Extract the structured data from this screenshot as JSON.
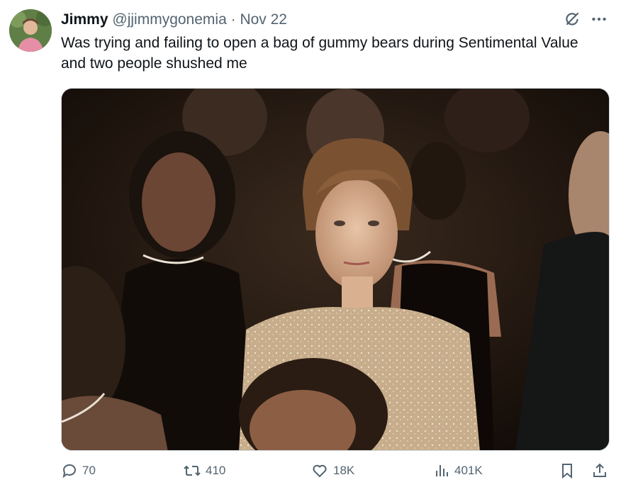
{
  "tweet": {
    "author_name": "Jimmy",
    "handle": "@jjimmygonemia",
    "separator": "·",
    "date": "Nov 22",
    "text": "Was trying and failing to open a bag of gummy bears during Sentimental Value and two people shushed me"
  },
  "icons": {
    "grok": "grok-icon",
    "more": "more-icon",
    "reply": "reply-icon",
    "retweet": "retweet-icon",
    "like": "like-icon",
    "views": "views-icon",
    "bookmark": "bookmark-icon",
    "share": "share-icon"
  },
  "actions": {
    "replies": "70",
    "retweets": "410",
    "likes": "18K",
    "views": "401K"
  },
  "colors": {
    "text": "#0f1419",
    "muted": "#536471",
    "border": "#cfd9de"
  }
}
